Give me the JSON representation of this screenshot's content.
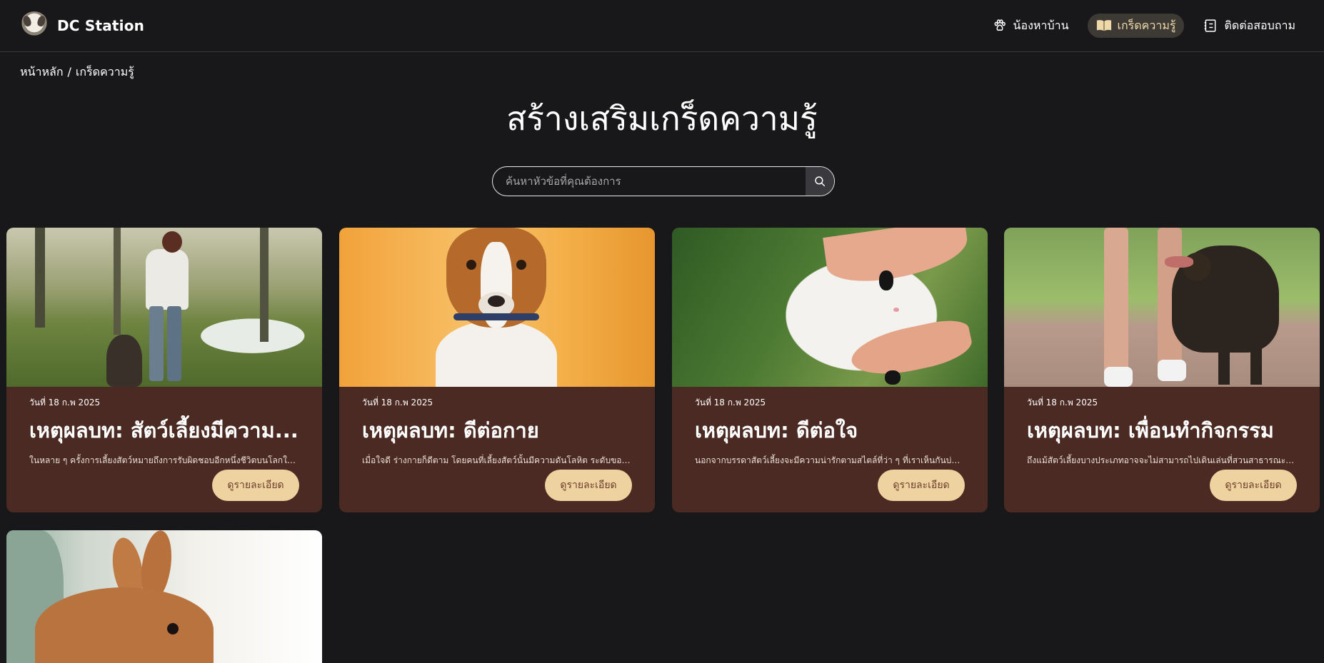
{
  "brand": {
    "name": "DC Station"
  },
  "nav": {
    "items": [
      {
        "label": "น้องหาบ้าน",
        "icon": "paw-icon",
        "active": false
      },
      {
        "label": "เกร็ดความรู้",
        "icon": "book-icon",
        "active": true
      },
      {
        "label": "ติดต่อสอบถาม",
        "icon": "contact-icon",
        "active": false
      }
    ]
  },
  "breadcrumb": {
    "home": "หน้าหลัก",
    "separator": "/",
    "current": "เกร็ดความรู้"
  },
  "page": {
    "title": "สร้างเสริมเกร็ดความรู้"
  },
  "search": {
    "placeholder": "ค้นหาหัวข้อที่คุณต้องการ",
    "value": ""
  },
  "cards": [
    {
      "date": "วันที่ 18 ก.พ 2025",
      "title": "เหตุผลบท: สัตว์เลี้ยงมีความ...",
      "description": "ในหลาย ๆ ครั้งการเลี้ยงสัตว์หมายถึงการรับผิดชอบอีกหนึ่งชีวิตบนโลกใบนี้ ซึ่ง...",
      "button": "ดูรายละเอียด",
      "image": "girl-with-dog-in-park"
    },
    {
      "date": "วันที่ 18 ก.พ 2025",
      "title": "เหตุผลบท: ดีต่อกาย",
      "description": "เมื่อใจดี ร่างกายก็ดีตาม โดยคนที่เลี้ยงสัตว์นั้นมีความดันโลหิต ระดับของคอเลส...",
      "button": "ดูรายละเอียด",
      "image": "jack-russell-dog"
    },
    {
      "date": "วันที่ 18 ก.พ 2025",
      "title": "เหตุผลบท: ดีต่อใจ",
      "description": "นอกจากบรรดาสัตว์เลี้ยงจะมีความน่ารักตามสไตล์ที่ว่า ๆ ที่เราเห็นกันบ่อย ๆ ตา...",
      "button": "ดูรายละเอียด",
      "image": "white-cat-petted"
    },
    {
      "date": "วันที่ 18 ก.พ 2025",
      "title": "เหตุผลบท: เพื่อนทำกิจกรรม",
      "description": "ถึงแม้สัตว์เลี้ยงบางประเภทอาจจะไม่สามารถไปเดินเล่นที่สวนสาธารณะกับเราได้ไ...",
      "button": "ดูรายละเอียด",
      "image": "dog-walking-on-leash"
    },
    {
      "date": "",
      "title": "",
      "description": "",
      "button": "",
      "image": "brown-rabbit"
    }
  ],
  "colors": {
    "background": "#18181a",
    "card": "#4a2a22",
    "button": "#eed2a0",
    "accent": "#efd9a8"
  }
}
